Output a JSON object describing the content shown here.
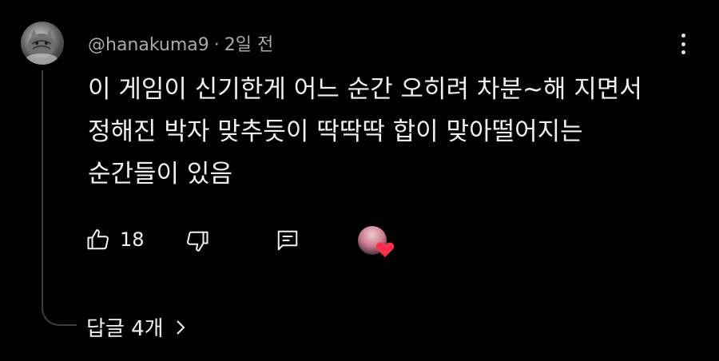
{
  "comment": {
    "author": "@hanakuma9",
    "separator": "·",
    "time": "2일 전",
    "lines": [
      "이 게임이 신기한게 어느 순간 오히려 차분~해 지면서",
      "정해진 박자 맞추듯이 딱딱딱 합이 맞아떨어지는",
      "순간들이 있음"
    ],
    "like_count": "18",
    "replies_label": "답글 4개"
  },
  "icons": {
    "like": "thumbs-up-icon",
    "dislike": "thumbs-down-icon",
    "reply": "comment-icon",
    "more": "more-vertical-icon",
    "heart": "heart-icon",
    "chevron": "chevron-right-icon"
  },
  "colors": {
    "background": "#000000",
    "text": "#f1f1f1",
    "meta": "#aaaaaa",
    "heart": "#ff2f4b"
  }
}
